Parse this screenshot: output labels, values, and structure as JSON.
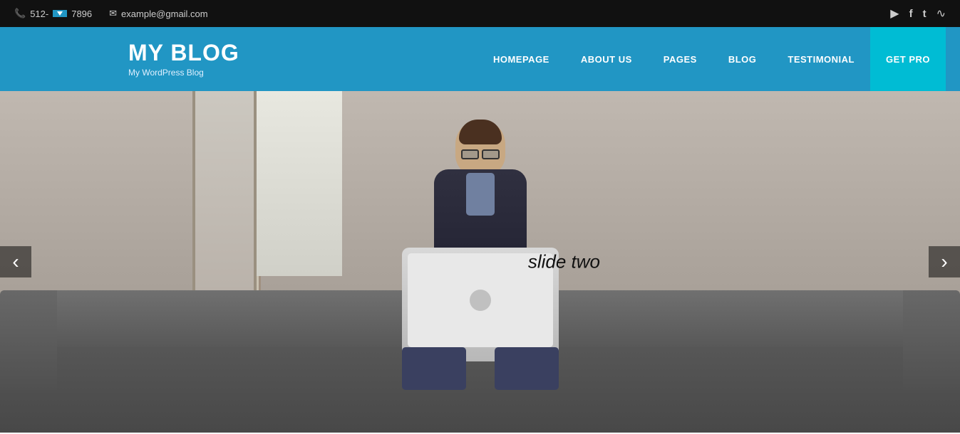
{
  "topbar": {
    "phone": "512-7896",
    "email": "example@gmail.com",
    "phone_display": "512-",
    "phone_suffix": "7896"
  },
  "brand": {
    "title": "MY BLOG",
    "subtitle": "My WordPress Blog"
  },
  "nav": {
    "items": [
      {
        "label": "HOMEPAGE",
        "id": "homepage"
      },
      {
        "label": "ABOUT US",
        "id": "about-us"
      },
      {
        "label": "PAGES",
        "id": "pages"
      },
      {
        "label": "BLOG",
        "id": "blog"
      },
      {
        "label": "TESTIMONIAL",
        "id": "testimonial"
      }
    ],
    "cta": "GET PRO"
  },
  "slider": {
    "slide_text": "slide two",
    "arrow_left": "‹",
    "arrow_right": "›"
  },
  "social": {
    "youtube": "▶",
    "facebook": "f",
    "twitter": "t",
    "rss": "☰"
  }
}
